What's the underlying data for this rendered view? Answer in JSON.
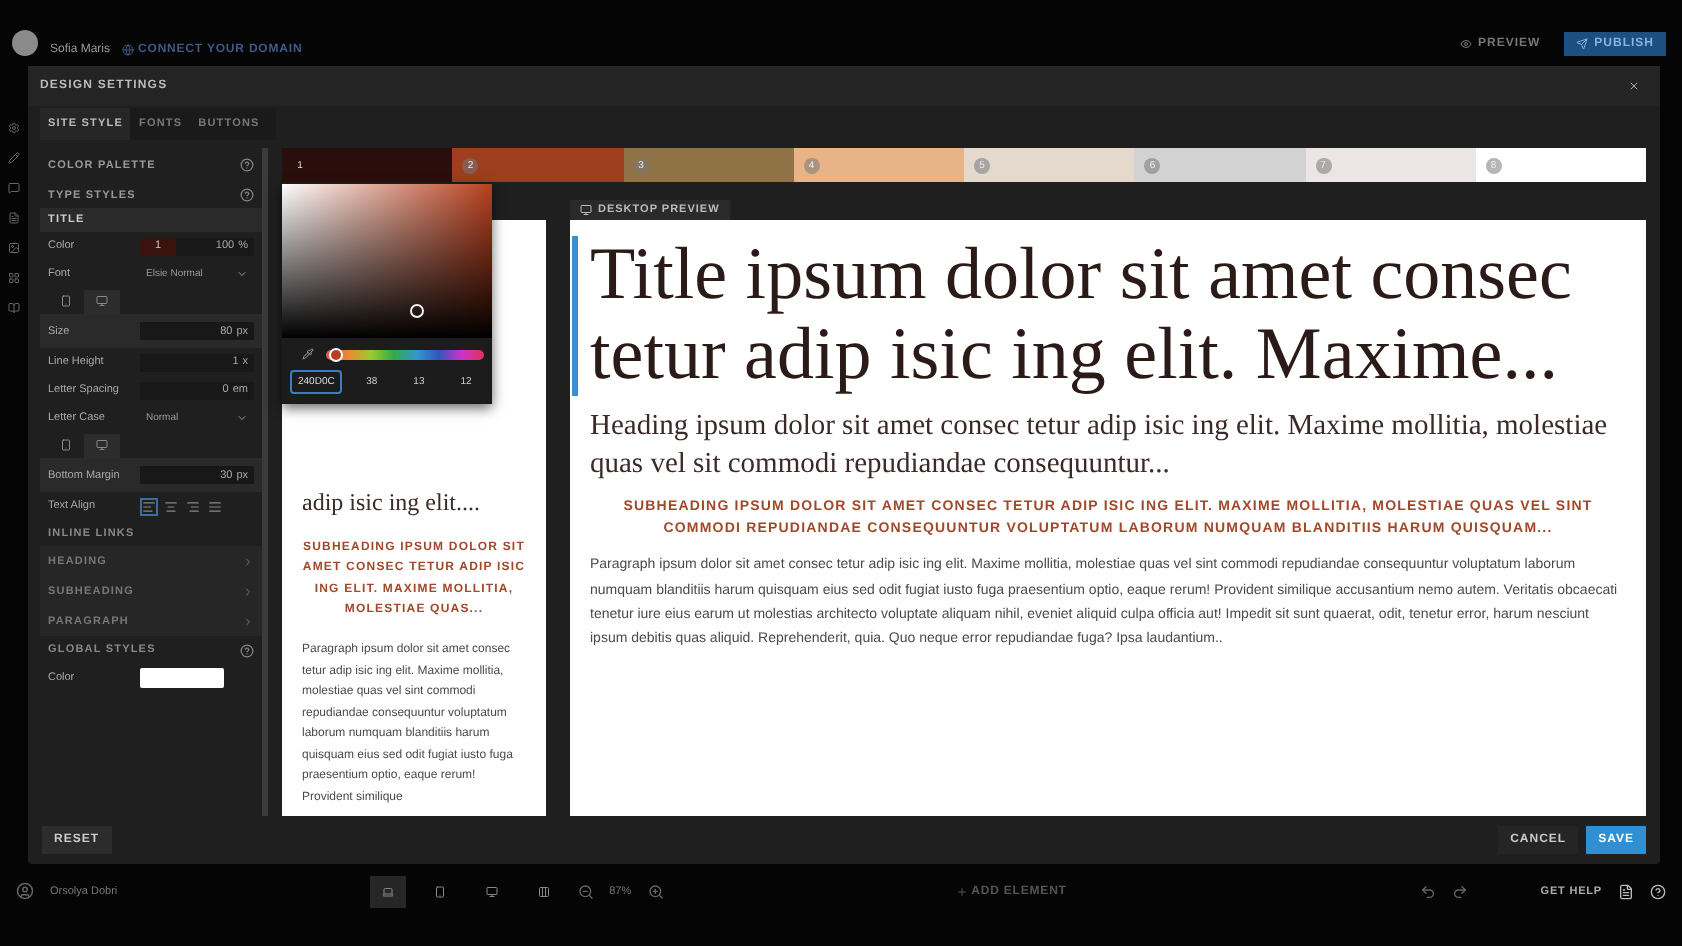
{
  "top_bar": {
    "site_name": "Sofia Maris",
    "domain_link": "CONNECT YOUR DOMAIN",
    "preview_button": "PREVIEW",
    "publish_button": "PUBLISH"
  },
  "dialog": {
    "title": "DESIGN SETTINGS"
  },
  "tabs": [
    {
      "label": "SITE STYLE",
      "selected": true
    },
    {
      "label": "FONTS",
      "selected": false
    },
    {
      "label": "BUTTONS",
      "selected": false
    }
  ],
  "settings": {
    "color_palette_label": "COLOR PALETTE",
    "type_styles_label": "TYPE STYLES",
    "section_title": "TITLE",
    "rows": [
      {
        "kind": "color",
        "label": "Color",
        "swatch": "1",
        "value": "100",
        "unit": "%"
      },
      {
        "kind": "select",
        "label": "Font",
        "value": "Elsie Normal"
      },
      {
        "kind": "devices",
        "devices": [
          {
            "selected": false
          },
          {
            "selected": true
          }
        ]
      },
      {
        "kind": "number",
        "label": "Size",
        "value": "80",
        "unit": "px",
        "device_specific": true
      },
      {
        "kind": "number",
        "label": "Line Height",
        "value": "1",
        "unit": "x",
        "device_specific": false
      },
      {
        "kind": "number",
        "label": "Letter Spacing",
        "value": "0",
        "unit": "em",
        "device_specific": false
      },
      {
        "kind": "select",
        "label": "Letter Case",
        "value": "Normal"
      },
      {
        "kind": "devices",
        "devices": [
          {
            "selected": false
          },
          {
            "selected": true
          }
        ]
      },
      {
        "kind": "number",
        "label": "Bottom Margin",
        "value": "30",
        "unit": "px",
        "device_specific": true
      },
      {
        "kind": "align",
        "label": "Text Align",
        "options": [
          {
            "selected": true
          },
          {
            "selected": false
          },
          {
            "selected": false
          },
          {
            "selected": false
          }
        ]
      }
    ],
    "inline_links_label": "INLINE LINKS",
    "inline_links": [
      {
        "label": "HEADING",
        "expanded": false
      },
      {
        "label": "SUBHEADING",
        "expanded": false
      },
      {
        "label": "PARAGRAPH",
        "expanded": false
      }
    ],
    "global_styles_label": "GLOBAL STYLES",
    "global_color": {
      "label": "Color",
      "color": "#ffffff"
    }
  },
  "palette": [
    {
      "label": "1",
      "color": "#2a0e0c",
      "selected": true
    },
    {
      "label": "2",
      "color": "#9e3e1f",
      "selected": false
    },
    {
      "label": "3",
      "color": "#8f7245",
      "selected": false
    },
    {
      "label": "4",
      "color": "#e8b487",
      "selected": false
    },
    {
      "label": "5",
      "color": "#e5d9ce",
      "selected": false
    },
    {
      "label": "6",
      "color": "#d2d2d2",
      "selected": false
    },
    {
      "label": "7",
      "color": "#ebe6e5",
      "selected": false
    },
    {
      "label": "8",
      "color": "#ffffff",
      "selected": false
    }
  ],
  "color_picker": {
    "hex": "240D0C",
    "channels": [
      "38",
      "13",
      "12"
    ],
    "hue_slider": {
      "level": 0.03
    }
  },
  "desktop_label": "DESKTOP PREVIEW",
  "mobile_preview": {
    "heading": "adip isic ing elit....",
    "subheading": "SUBHEADING IPSUM DOLOR SIT AMET CONSEC TETUR ADIP ISIC ING ELIT. MAXIME MOLLITIA, MOLESTIAE QUAS...",
    "paragraph": "Paragraph ipsum dolor sit amet consec tetur adip isic ing elit. Maxime mollitia, molestiae quas vel sint commodi repudiandae consequuntur voluptatum laborum numquam blanditiis harum quisquam eius sed odit fugiat iusto fuga praesentium optio, eaque rerum! Provident similique"
  },
  "desktop_preview": {
    "title": "Title ipsum dolor sit amet consec tetur adip isic ing elit. Maxime...",
    "heading": "Heading ipsum dolor sit amet consec tetur adip isic ing elit. Maxime mollitia, molestiae quas vel sit commodi repudiandae consequuntur...",
    "subheading": "SUBHEADING IPSUM DOLOR SIT AMET CONSEC TETUR ADIP ISIC ING ELIT. MAXIME MOLLITIA, MOLESTIAE QUAS VEL SINT COMMODI REPUDIANDAE CONSEQUUNTUR VOLUPTATUM LABORUM NUMQUAM BLANDITIIS HARUM QUISQUAM...",
    "paragraph": "Paragraph ipsum dolor sit amet consec tetur adip isic ing elit. Maxime mollitia, molestiae quas vel sint commodi repudiandae consequuntur voluptatum laborum numquam blanditiis harum quisquam eius sed odit fugiat iusto fuga praesentium optio, eaque rerum! Provident similique accusantium nemo autem. Veritatis obcaecati tenetur iure eius earum ut molestias architecto voluptate aliquam nihil, eveniet aliquid culpa officia aut! Impedit sit sunt quaerat, odit, tenetur error, harum nesciunt ipsum debitis quas aliquid. Reprehenderit, quia. Quo neque error repudiandae fuga? Ipsa laudantium..",
    "title_selected": true
  },
  "footer": {
    "reset": "RESET",
    "cancel": "CANCEL",
    "save": "SAVE"
  },
  "bottom_bar": {
    "user": "Orsolya Dobri",
    "tools": [
      {
        "kind": "laptop",
        "selected": true
      },
      {
        "kind": "phone",
        "selected": false
      },
      {
        "kind": "monitor",
        "selected": false
      },
      {
        "kind": "grid",
        "selected": false
      }
    ],
    "zoom": "87%",
    "add_element": "ADD ELEMENT",
    "help": "GET HELP"
  }
}
